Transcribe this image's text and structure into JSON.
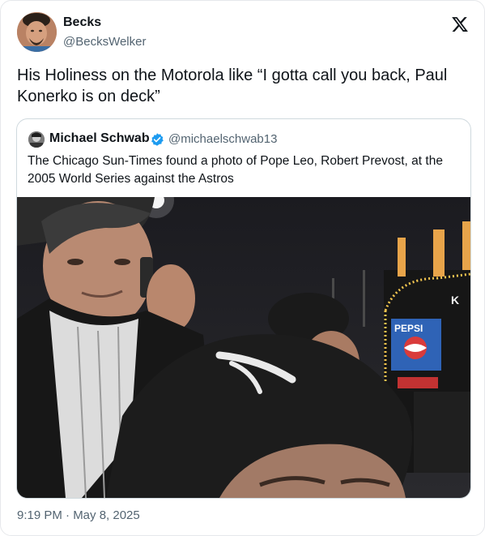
{
  "tweet": {
    "author_name": "Becks",
    "author_handle": "@BecksWelker",
    "text": "His Holiness on the Motorola like “I gotta call you back, Paul Konerko is on deck”",
    "timestamp": "9:19 PM · May 8, 2025"
  },
  "quoted": {
    "author_name": "Michael Schwab",
    "author_handle": "@michaelschwab13",
    "verified": true,
    "text": "The Chicago Sun-Times found a photo of Pope Leo, Robert Prevost, at the 2005 World Series against the Astros",
    "photo": {
      "sign_text": "PEPSI",
      "scoreboard_letter": "K"
    }
  },
  "icons": {
    "brand": "x-logo-icon",
    "verified": "verified-badge-icon"
  },
  "colors": {
    "text": "#0f1419",
    "secondary": "#536471",
    "border": "#cfd9de",
    "verified": "#1d9bf0"
  }
}
